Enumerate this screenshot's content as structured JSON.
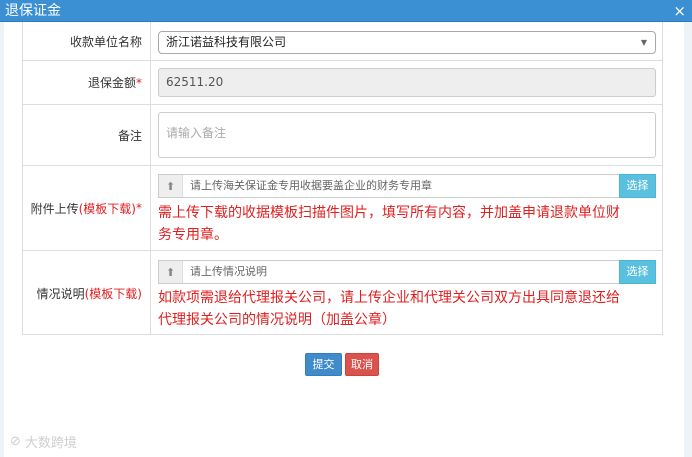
{
  "dialog": {
    "title": "退保证金",
    "close_symbol": "×"
  },
  "fields": {
    "payee": {
      "label": "收款单位名称",
      "value": "浙江诺益科技有限公司",
      "arrow": "▼"
    },
    "amount": {
      "label": "退保金额",
      "required_mark": "*",
      "value": "62511.20"
    },
    "remarks": {
      "label": "备注",
      "placeholder": "请输入备注"
    },
    "attachment": {
      "label_prefix": "附件上传",
      "template_link": "(模板下载)",
      "required_mark": "*",
      "placeholder": "请上传海关保证金专用收据要盖企业的财务专用章",
      "select_label": "选择",
      "note_line1": "需上传下载的收据模板扫描件图片，填写所有内容，并加盖申请退款单位财",
      "note_line2": "务专用章。"
    },
    "situation": {
      "label_prefix": "情况说明",
      "template_link": "(模板下载)",
      "placeholder": "请上传情况说明",
      "select_label": "选择",
      "note_line1": "如款项需退给代理报关公司，请上传企业和代理关公司双方出具同意退还给",
      "note_line2": "代理报关公司的情况说明（加盖公章）"
    }
  },
  "actions": {
    "submit": "提交",
    "cancel": "取消"
  },
  "watermark": {
    "icon": "⊘",
    "text": "大数跨境"
  }
}
